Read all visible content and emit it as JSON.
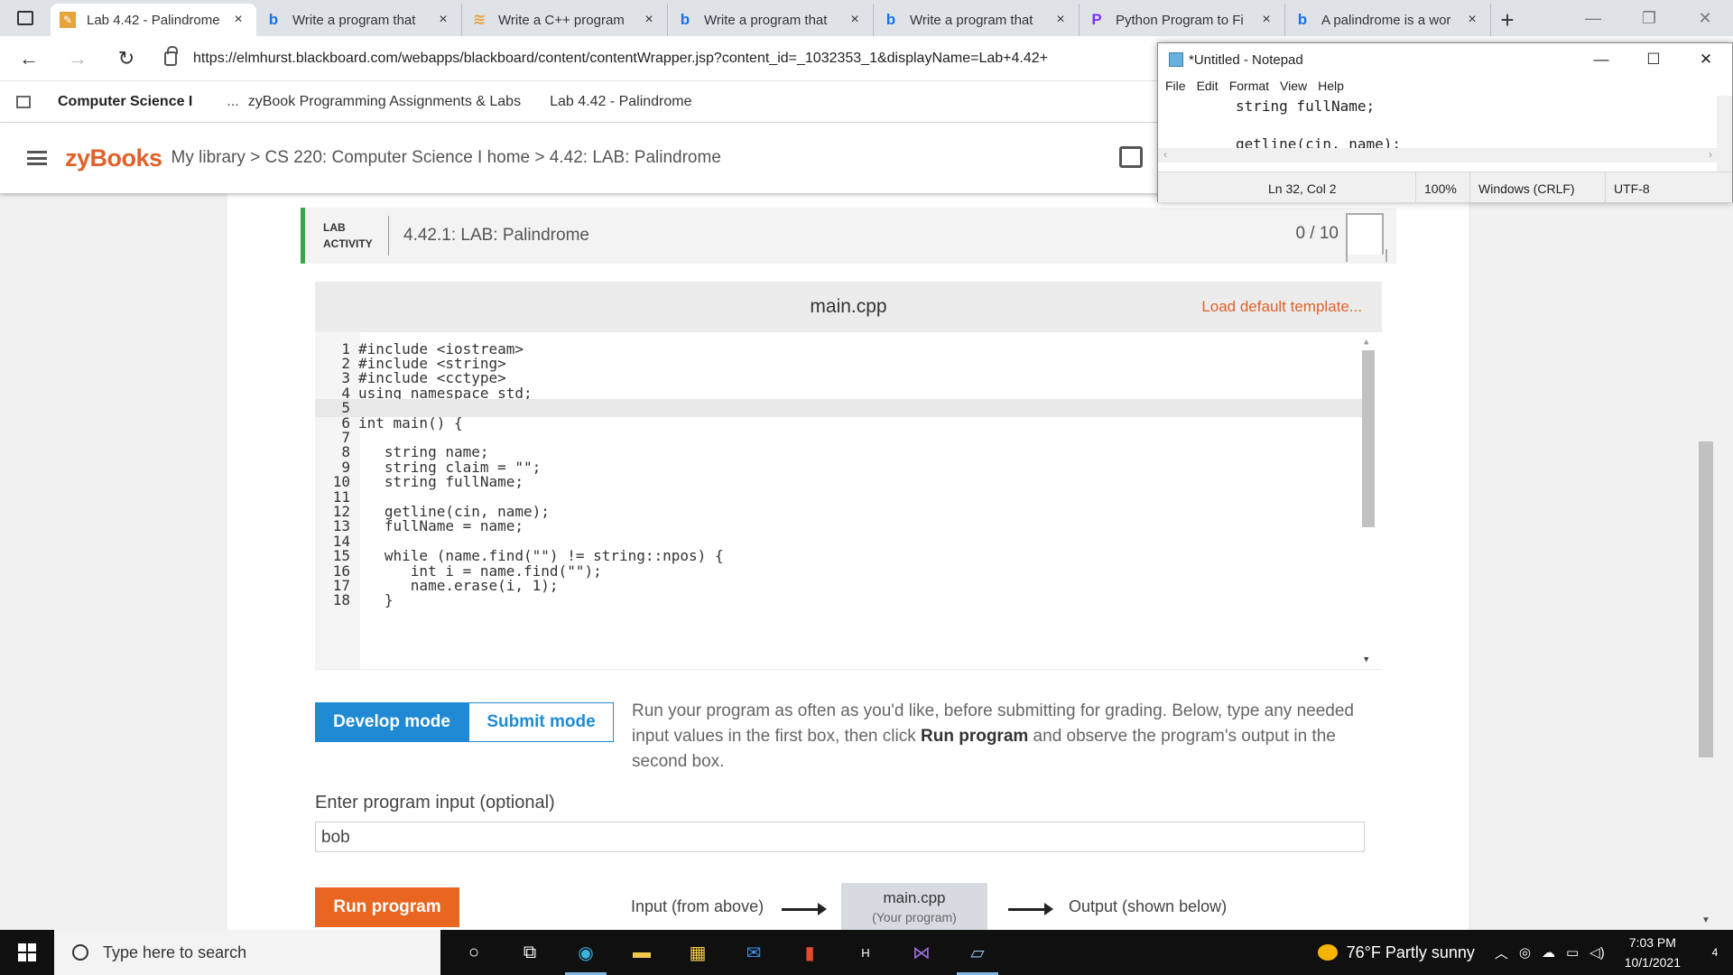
{
  "browser": {
    "tabs": [
      {
        "label": "Lab 4.42 - Palindrome",
        "icon": "pencil-icon",
        "active": true
      },
      {
        "label": "Write a program that",
        "icon": "bing-icon",
        "active": false
      },
      {
        "label": "Write a C++ program",
        "icon": "stack-icon",
        "active": false
      },
      {
        "label": "Write a program that",
        "icon": "bing-icon",
        "active": false
      },
      {
        "label": "Write a program that",
        "icon": "bing-icon",
        "active": false
      },
      {
        "label": "Python Program to Fi",
        "icon": "p-icon",
        "active": false
      },
      {
        "label": "A palindrome is a wor",
        "icon": "bing-icon",
        "active": false
      }
    ],
    "tab_close": "×",
    "new_tab": "+",
    "url": "https://elmhurst.blackboard.com/webapps/blackboard/content/contentWrapper.jsp?content_id=_1032353_1&displayName=Lab+4.42+"
  },
  "blackboard": {
    "course": "Computer Science I",
    "ellipsis": "...",
    "crumbs": [
      "zyBook Programming Assignments & Labs",
      "Lab 4.42 - Palindrome"
    ]
  },
  "zybooks": {
    "logo": "zyBooks",
    "breadcrumb": "My library > CS 220: Computer Science I home > 4.42: LAB: Palindrome"
  },
  "lab": {
    "tag_line1": "LAB",
    "tag_line2": "ACTIVITY",
    "title": "4.42.1: LAB: Palindrome",
    "score": "0 / 10"
  },
  "editor": {
    "filename": "main.cpp",
    "load_template": "Load default template...",
    "current_line": 5,
    "lines": [
      "#include <iostream>",
      "#include <string>",
      "#include <cctype>",
      "using namespace std;",
      "",
      "int main() {",
      "",
      "   string name;",
      "   string claim = \"\";",
      "   string fullName;",
      "",
      "   getline(cin, name);",
      "   fullName = name;",
      "",
      "   while (name.find(\"\") != string::npos) {",
      "      int i = name.find(\"\");",
      "      name.erase(i, 1);",
      "   }"
    ]
  },
  "modes": {
    "develop": "Develop mode",
    "submit": "Submit mode",
    "desc_pre": "Run your program as often as you'd like, before submitting for grading. Below, type any needed input values in the first box, then click ",
    "desc_bold": "Run program",
    "desc_post": " and observe the program's output in the second box."
  },
  "input": {
    "label": "Enter program input (optional)",
    "value": "bob"
  },
  "run": {
    "button": "Run program",
    "flow_in": "Input (from above)",
    "box_title": "main.cpp",
    "box_sub": "(Your program)",
    "flow_out": "Output (shown below)"
  },
  "notepad": {
    "title": "*Untitled - Notepad",
    "menu": [
      "File",
      "Edit",
      "Format",
      "View",
      "Help"
    ],
    "text_lines": [
      "string fullName;",
      "",
      "getline(cin, name);"
    ],
    "status_pos": "Ln 32, Col 2",
    "status_zoom": "100%",
    "status_eol": "Windows (CRLF)",
    "status_enc": "UTF-8"
  },
  "taskbar": {
    "search_placeholder": "Type here to search",
    "weather": "76°F  Partly sunny",
    "time": "7:03 PM",
    "date": "10/1/2021",
    "notifications": "4"
  },
  "colors": {
    "accent_orange": "#e0622a",
    "develop_blue": "#1f8ad3",
    "lab_green": "#3ea34a"
  }
}
